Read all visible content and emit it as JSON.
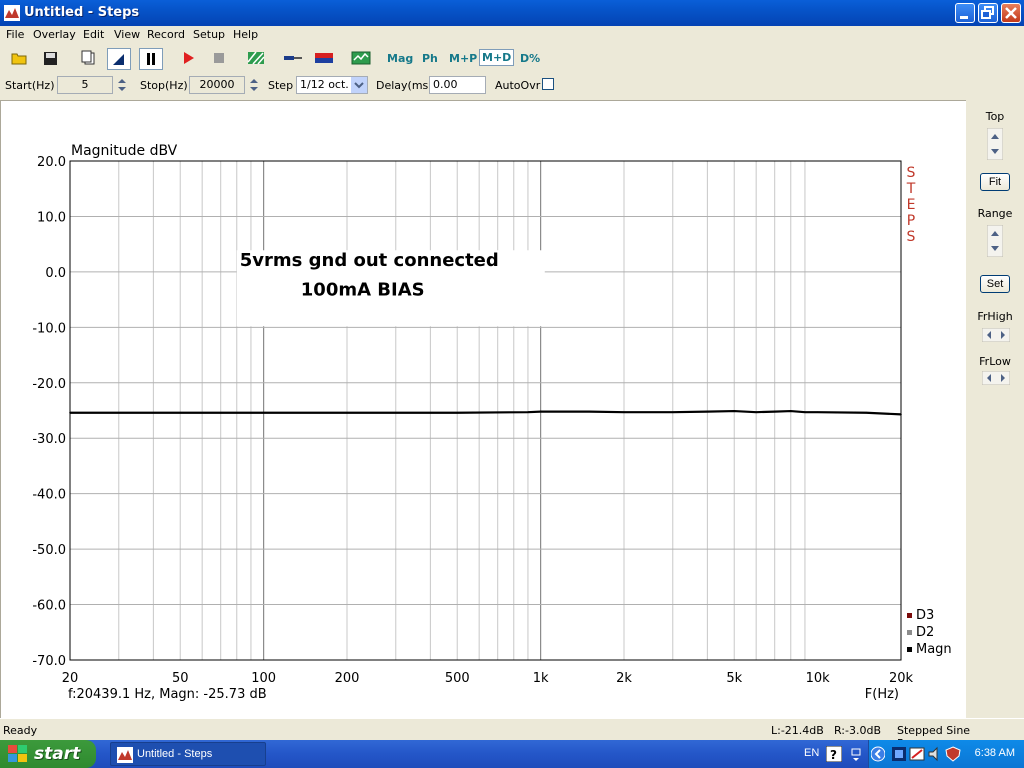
{
  "window": {
    "title": "Untitled - Steps"
  },
  "menu": [
    "File",
    "Overlay",
    "Edit",
    "View",
    "Record",
    "Setup",
    "Help"
  ],
  "toolbar": {
    "icons": [
      "open-icon",
      "save-icon",
      "copy-icon",
      "cursor-icon",
      "pause-icon",
      "play-icon",
      "stop-icon",
      "hatch-icon",
      "probe-icon",
      "colorbar-icon",
      "scope-icon"
    ],
    "views": [
      "Mag",
      "Ph",
      "M+P",
      "M+D",
      "D%"
    ],
    "active_view": "M+D"
  },
  "params": {
    "start_label": "Start(Hz)",
    "start_value": "5",
    "stop_label": "Stop(Hz)",
    "stop_value": "20000",
    "step_label": "Step",
    "step_value": "1/12 oct.",
    "delay_label": "Delay(ms)",
    "delay_value": "0.00",
    "autoovr_label": "AutoOvr",
    "autoovr_checked": false
  },
  "sidepanel": {
    "top_label": "Top",
    "fit_label": "Fit",
    "range_label": "Range",
    "set_label": "Set",
    "frhigh_label": "FrHigh",
    "frlow_label": "FrLow"
  },
  "chart_data": {
    "type": "line",
    "ylabel": "Magnitude dBV",
    "xlabel": "F(Hz)",
    "yticks": [
      "20.0",
      "10.0",
      "0.0",
      "-10.0",
      "-20.0",
      "-30.0",
      "-40.0",
      "-50.0",
      "-60.0",
      "-70.0"
    ],
    "ylim": [
      -70,
      20
    ],
    "xlim": [
      20,
      20000
    ],
    "xscale": "log",
    "xticks": [
      {
        "v": 20,
        "t": "20"
      },
      {
        "v": 50,
        "t": "50"
      },
      {
        "v": 100,
        "t": "100"
      },
      {
        "v": 200,
        "t": "200"
      },
      {
        "v": 500,
        "t": "500"
      },
      {
        "v": 1000,
        "t": "1k"
      },
      {
        "v": 2000,
        "t": "2k"
      },
      {
        "v": 5000,
        "t": "5k"
      },
      {
        "v": 10000,
        "t": "10k"
      },
      {
        "v": 20000,
        "t": "20k"
      }
    ],
    "annotation": [
      "5vrms gnd out connected",
      "100mA BIAS"
    ],
    "watermark": "STEPS",
    "cursor_readout": "f:20439.1 Hz, Magn: -25.73 dB",
    "legend": [
      {
        "name": "D3",
        "color": "#7a0a0a"
      },
      {
        "name": "D2",
        "color": "#8c8c8c"
      },
      {
        "name": "Magn",
        "color": "#000000"
      }
    ],
    "grid": true,
    "series": [
      {
        "name": "Magn",
        "color": "#000000",
        "x": [
          20,
          50,
          100,
          200,
          500,
          900,
          1000,
          1500,
          2000,
          3000,
          4000,
          5000,
          6000,
          7000,
          8000,
          9000,
          10000,
          15000,
          20000
        ],
        "y": [
          -25.4,
          -25.4,
          -25.4,
          -25.4,
          -25.4,
          -25.3,
          -25.2,
          -25.2,
          -25.3,
          -25.3,
          -25.2,
          -25.1,
          -25.3,
          -25.2,
          -25.1,
          -25.3,
          -25.3,
          -25.4,
          -25.7
        ]
      }
    ]
  },
  "status": {
    "left": "Ready",
    "l_readout": "L:-21.4dB",
    "r_readout": "R:-3.0dB",
    "mode": "Stepped Sine Response"
  },
  "taskbar": {
    "start_label": "start",
    "task_label": "Untitled - Steps",
    "lang": "EN",
    "clock": "6:38 AM"
  }
}
